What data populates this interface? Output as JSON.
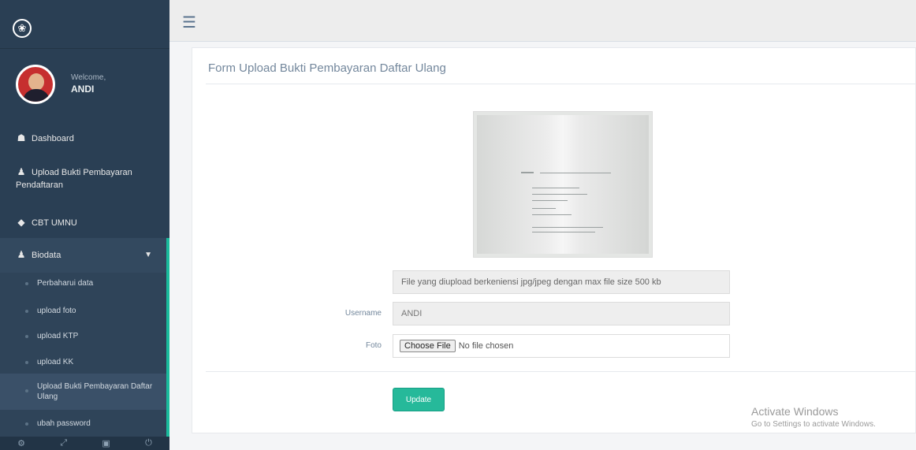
{
  "sidebar": {
    "welcome": "Welcome,",
    "username": "ANDI",
    "menu": {
      "dashboard": "Dashboard",
      "upload_line1": "Upload Bukti Pembayaran",
      "upload_line2": "Pendaftaran",
      "cbt": "CBT UMNU",
      "biodata": "Biodata"
    },
    "submenu": [
      "Perbaharui data",
      "upload foto",
      "upload KTP",
      "upload KK",
      "Upload Bukti Pembayaran Daftar Ulang",
      "ubah password"
    ]
  },
  "panel": {
    "title": "Form Upload Bukti Pembayaran Daftar Ulang",
    "info": "File yang diupload berkeniensi jpg/jpeg dengan max file size 500 kb",
    "username_label": "Username",
    "username_value": "ANDI",
    "foto_label": "Foto",
    "choose_file": "Choose File",
    "no_file": "No file chosen",
    "update": "Update"
  },
  "watermark": {
    "line1": "Activate Windows",
    "line2": "Go to Settings to activate Windows."
  },
  "colors": {
    "sidebar_bg": "#2a3f54",
    "accent": "#1abb9c",
    "button": "#26b99a"
  }
}
